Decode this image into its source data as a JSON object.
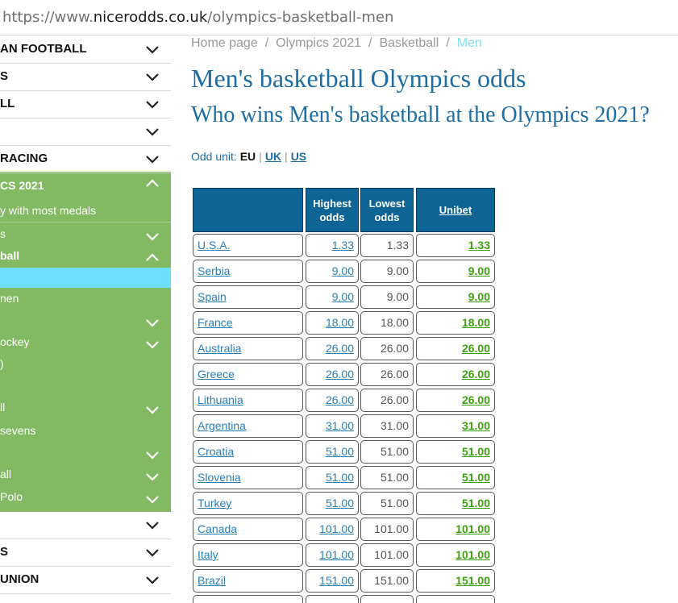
{
  "browser": {
    "url_prefix": "https://www.",
    "url_domain": "nicerodds.co.uk",
    "url_path": "/olympics-basketball-men"
  },
  "sidebar": {
    "items_top": [
      {
        "label": "AN FOOTBALL"
      },
      {
        "label": "S"
      },
      {
        "label": "LL"
      },
      {
        "label": ""
      },
      {
        "label": "RACING"
      }
    ],
    "olympics": {
      "label": "CS 2021"
    },
    "olympics_sub": [
      {
        "label": "y with most medals",
        "bold": false,
        "chevron": "none"
      },
      {
        "label": "s",
        "bold": false,
        "chevron": "down"
      },
      {
        "label": "ball",
        "bold": true,
        "chevron": "up"
      },
      {
        "label": "",
        "bold": false,
        "chevron": "none"
      },
      {
        "label": "nen",
        "bold": false,
        "chevron": "none"
      },
      {
        "label": "",
        "bold": false,
        "chevron": "down"
      },
      {
        "label": "ockey",
        "bold": false,
        "chevron": "down"
      },
      {
        "label": ")",
        "bold": false,
        "chevron": "none"
      },
      {
        "label": "ll",
        "bold": false,
        "chevron": "down"
      },
      {
        "label": "sevens",
        "bold": false,
        "chevron": "none"
      },
      {
        "label": "",
        "bold": false,
        "chevron": "down"
      },
      {
        "label": "all",
        "bold": false,
        "chevron": "down"
      },
      {
        "label": "Polo",
        "bold": false,
        "chevron": "down"
      }
    ],
    "items_bottom": [
      {
        "label": ""
      },
      {
        "label": "S"
      },
      {
        "label": "UNION"
      }
    ]
  },
  "breadcrumb": {
    "items": [
      "Home page",
      "Olympics 2021",
      "Basketball"
    ],
    "separator": "/",
    "current": "Men"
  },
  "page": {
    "title": "Men's basketball Olympics odds",
    "subtitle": "Who wins Men's basketball at the Olympics 2021?",
    "odd_unit_label": "Odd unit:",
    "odd_units": [
      "EU",
      "UK",
      "US"
    ],
    "active_unit": "EU"
  },
  "table": {
    "headers": {
      "team": "",
      "highest": "Highest odds",
      "lowest": "Lowest odds",
      "bookmaker": "Unibet"
    },
    "rows": [
      {
        "team": "U.S.A.",
        "highest": "1.33",
        "lowest": "1.33",
        "unibet": "1.33"
      },
      {
        "team": "Serbia",
        "highest": "9.00",
        "lowest": "9.00",
        "unibet": "9.00"
      },
      {
        "team": "Spain",
        "highest": "9.00",
        "lowest": "9.00",
        "unibet": "9.00"
      },
      {
        "team": "France",
        "highest": "18.00",
        "lowest": "18.00",
        "unibet": "18.00"
      },
      {
        "team": "Australia",
        "highest": "26.00",
        "lowest": "26.00",
        "unibet": "26.00"
      },
      {
        "team": "Greece",
        "highest": "26.00",
        "lowest": "26.00",
        "unibet": "26.00"
      },
      {
        "team": "Lithuania",
        "highest": "26.00",
        "lowest": "26.00",
        "unibet": "26.00"
      },
      {
        "team": "Argentina",
        "highest": "31.00",
        "lowest": "31.00",
        "unibet": "31.00"
      },
      {
        "team": "Croatia",
        "highest": "51.00",
        "lowest": "51.00",
        "unibet": "51.00"
      },
      {
        "team": "Slovenia",
        "highest": "51.00",
        "lowest": "51.00",
        "unibet": "51.00"
      },
      {
        "team": "Turkey",
        "highest": "51.00",
        "lowest": "51.00",
        "unibet": "51.00"
      },
      {
        "team": "Canada",
        "highest": "101.00",
        "lowest": "101.00",
        "unibet": "101.00"
      },
      {
        "team": "Italy",
        "highest": "101.00",
        "lowest": "101.00",
        "unibet": "101.00"
      },
      {
        "team": "Brazil",
        "highest": "151.00",
        "lowest": "151.00",
        "unibet": "151.00"
      }
    ]
  },
  "colors": {
    "heading": "#1c6ea4",
    "sidebar_green": "#82b962",
    "sidebar_active": "#6ee0ff",
    "table_header": "#0f6496",
    "best_odds": "#3fa014"
  }
}
